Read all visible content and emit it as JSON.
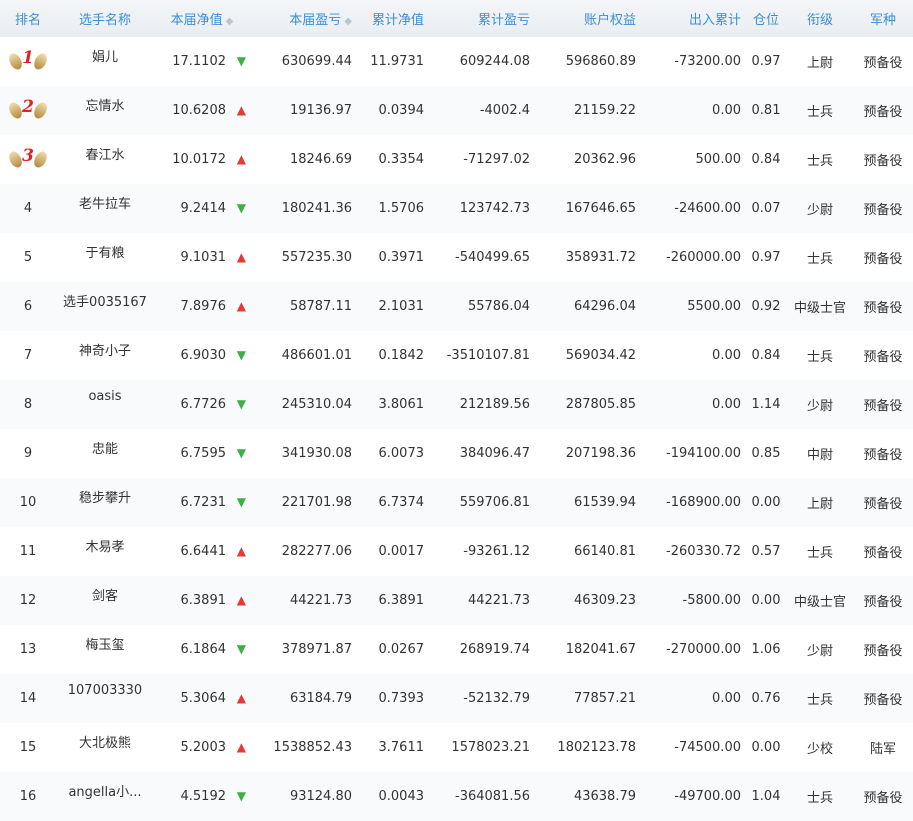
{
  "headers": {
    "rank": "排名",
    "name": "选手名称",
    "nav": "本届净值",
    "pnl": "本届盈亏",
    "cum_nav": "累计净值",
    "cum_pnl": "累计盈亏",
    "equity": "账户权益",
    "inout": "出入累计",
    "position": "仓位",
    "title": "衔级",
    "branch": "军种"
  },
  "colors": {
    "header_text": "#3a8fd8",
    "up_arrow": "#e53935",
    "down_arrow": "#3cb043",
    "medal_number": "#e02222"
  },
  "rows": [
    {
      "rank": "1",
      "name": "娟儿",
      "nav": "17.1102",
      "trend": "down",
      "pnl": "630699.44",
      "cum_nav": "11.9731",
      "cum_pnl": "609244.08",
      "equity": "596860.89",
      "inout": "-73200.00",
      "position": "0.97",
      "title": "上尉",
      "branch": "预备役"
    },
    {
      "rank": "2",
      "name": "忘情水",
      "nav": "10.6208",
      "trend": "up",
      "pnl": "19136.97",
      "cum_nav": "0.0394",
      "cum_pnl": "-4002.4",
      "equity": "21159.22",
      "inout": "0.00",
      "position": "0.81",
      "title": "士兵",
      "branch": "预备役"
    },
    {
      "rank": "3",
      "name": "春江水",
      "nav": "10.0172",
      "trend": "up",
      "pnl": "18246.69",
      "cum_nav": "0.3354",
      "cum_pnl": "-71297.02",
      "equity": "20362.96",
      "inout": "500.00",
      "position": "0.84",
      "title": "士兵",
      "branch": "预备役"
    },
    {
      "rank": "4",
      "name": "老牛拉车",
      "nav": "9.2414",
      "trend": "down",
      "pnl": "180241.36",
      "cum_nav": "1.5706",
      "cum_pnl": "123742.73",
      "equity": "167646.65",
      "inout": "-24600.00",
      "position": "0.07",
      "title": "少尉",
      "branch": "预备役"
    },
    {
      "rank": "5",
      "name": "于有粮",
      "nav": "9.1031",
      "trend": "up",
      "pnl": "557235.30",
      "cum_nav": "0.3971",
      "cum_pnl": "-540499.65",
      "equity": "358931.72",
      "inout": "-260000.00",
      "position": "0.97",
      "title": "士兵",
      "branch": "预备役"
    },
    {
      "rank": "6",
      "name": "选手0035167",
      "nav": "7.8976",
      "trend": "up",
      "pnl": "58787.11",
      "cum_nav": "2.1031",
      "cum_pnl": "55786.04",
      "equity": "64296.04",
      "inout": "5500.00",
      "position": "0.92",
      "title": "中级士官",
      "branch": "预备役"
    },
    {
      "rank": "7",
      "name": "神奇小子",
      "nav": "6.9030",
      "trend": "down",
      "pnl": "486601.01",
      "cum_nav": "0.1842",
      "cum_pnl": "-3510107.81",
      "equity": "569034.42",
      "inout": "0.00",
      "position": "0.84",
      "title": "士兵",
      "branch": "预备役"
    },
    {
      "rank": "8",
      "name": "oasis",
      "nav": "6.7726",
      "trend": "down",
      "pnl": "245310.04",
      "cum_nav": "3.8061",
      "cum_pnl": "212189.56",
      "equity": "287805.85",
      "inout": "0.00",
      "position": "1.14",
      "title": "少尉",
      "branch": "预备役"
    },
    {
      "rank": "9",
      "name": "忠能",
      "nav": "6.7595",
      "trend": "down",
      "pnl": "341930.08",
      "cum_nav": "6.0073",
      "cum_pnl": "384096.47",
      "equity": "207198.36",
      "inout": "-194100.00",
      "position": "0.85",
      "title": "中尉",
      "branch": "预备役"
    },
    {
      "rank": "10",
      "name": "稳步攀升",
      "nav": "6.7231",
      "trend": "down",
      "pnl": "221701.98",
      "cum_nav": "6.7374",
      "cum_pnl": "559706.81",
      "equity": "61539.94",
      "inout": "-168900.00",
      "position": "0.00",
      "title": "上尉",
      "branch": "预备役"
    },
    {
      "rank": "11",
      "name": "木易孝",
      "nav": "6.6441",
      "trend": "up",
      "pnl": "282277.06",
      "cum_nav": "0.0017",
      "cum_pnl": "-93261.12",
      "equity": "66140.81",
      "inout": "-260330.72",
      "position": "0.57",
      "title": "士兵",
      "branch": "预备役"
    },
    {
      "rank": "12",
      "name": "剑客",
      "nav": "6.3891",
      "trend": "up",
      "pnl": "44221.73",
      "cum_nav": "6.3891",
      "cum_pnl": "44221.73",
      "equity": "46309.23",
      "inout": "-5800.00",
      "position": "0.00",
      "title": "中级士官",
      "branch": "预备役"
    },
    {
      "rank": "13",
      "name": "梅玉玺",
      "nav": "6.1864",
      "trend": "down",
      "pnl": "378971.87",
      "cum_nav": "0.0267",
      "cum_pnl": "268919.74",
      "equity": "182041.67",
      "inout": "-270000.00",
      "position": "1.06",
      "title": "少尉",
      "branch": "预备役"
    },
    {
      "rank": "14",
      "name": "107003330",
      "nav": "5.3064",
      "trend": "up",
      "pnl": "63184.79",
      "cum_nav": "0.7393",
      "cum_pnl": "-52132.79",
      "equity": "77857.21",
      "inout": "0.00",
      "position": "0.76",
      "title": "士兵",
      "branch": "预备役"
    },
    {
      "rank": "15",
      "name": "大北极熊",
      "nav": "5.2003",
      "trend": "up",
      "pnl": "1538852.43",
      "cum_nav": "3.7611",
      "cum_pnl": "1578023.21",
      "equity": "1802123.78",
      "inout": "-74500.00",
      "position": "0.00",
      "title": "少校",
      "branch": "陆军"
    },
    {
      "rank": "16",
      "name": "angella小...",
      "nav": "4.5192",
      "trend": "down",
      "pnl": "93124.80",
      "cum_nav": "0.0043",
      "cum_pnl": "-364081.56",
      "equity": "43638.79",
      "inout": "-49700.00",
      "position": "1.04",
      "title": "士兵",
      "branch": "预备役"
    }
  ]
}
